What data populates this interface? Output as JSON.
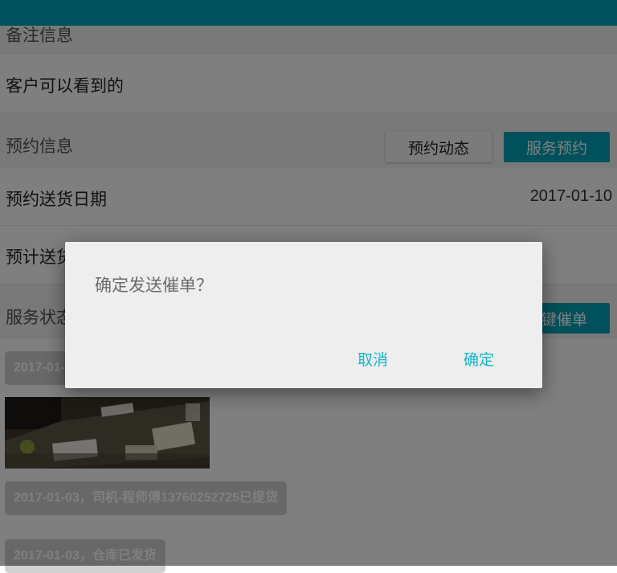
{
  "remark_section": {
    "title": "备注信息"
  },
  "remark_row": {
    "text": "客户可以看到的"
  },
  "appointment_section": {
    "title": "预约信息",
    "btn_dynamics": "预约动态",
    "btn_service": "服务预约"
  },
  "delivery_date_row": {
    "label": "预约送货日期",
    "value": "2017-01-10"
  },
  "estimate_row": {
    "label": "预计送货"
  },
  "service_section": {
    "title": "服务状态",
    "btn_urge": "一键催单"
  },
  "timeline": {
    "chip1": "2017-01-03",
    "chip2": "2017-01-03，司机-程师傅13760252725已提货",
    "chip3": "2017-01-03，仓库已发货"
  },
  "dialog": {
    "message": "确定发送催单？",
    "cancel": "取消",
    "confirm": "确定"
  },
  "colors": {
    "accent": "#00a3b7",
    "dialog_button": "#13b6cf"
  }
}
